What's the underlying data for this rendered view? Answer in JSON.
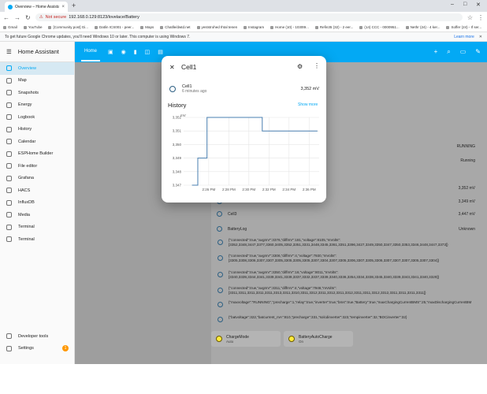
{
  "browser": {
    "tab_title": "Overview – Home Assistant",
    "not_secure": "Not secure",
    "url": "192.168.0.129:8123/lovelace/Battery",
    "bookmarks": [
      "Gmail",
      "YouTube",
      "[Community post] Gi...",
      "Datlin ICS001 - peer...",
      "Maps",
      "Chatlle/dwtd.net",
      "yeststrohed Ihtal tenen",
      "Instagram",
      "Home (10) - 1030t9...",
      "Refin35 (32) - 2 eer...",
      "(14) CCC - 0000951...",
      "Nethr (24) - 4 ker...",
      "Soffer (24) - If ser..."
    ],
    "info_text": "To get future Google Chrome updates, you'll need Windows 10 or later. This computer is using Windows 7.",
    "learn_more": "Learn more"
  },
  "sidebar": {
    "title": "Home Assistant",
    "items": [
      {
        "label": "Overview",
        "icon": "dashboard-icon",
        "active": true
      },
      {
        "label": "Map",
        "icon": "map-icon"
      },
      {
        "label": "Snapshots",
        "icon": "snapshot-icon"
      },
      {
        "label": "Energy",
        "icon": "lightning-icon"
      },
      {
        "label": "Logbook",
        "icon": "logbook-icon"
      },
      {
        "label": "History",
        "icon": "history-icon"
      },
      {
        "label": "Calendar",
        "icon": "calendar-icon"
      },
      {
        "label": "ESPHome Builder",
        "icon": "esphome-icon"
      },
      {
        "label": "File editor",
        "icon": "wrench-icon"
      },
      {
        "label": "Grafana",
        "icon": "grafana-icon"
      },
      {
        "label": "HACS",
        "icon": "hacs-icon"
      },
      {
        "label": "InfluxDB",
        "icon": "influxdb-icon"
      },
      {
        "label": "Media",
        "icon": "media-icon"
      },
      {
        "label": "Terminal",
        "icon": "terminal-icon"
      },
      {
        "label": "Terminal",
        "icon": "terminal-icon"
      }
    ],
    "developer_tools": "Developer tools",
    "settings": "Settings",
    "settings_badge": "1"
  },
  "topbar": {
    "home_tab": "Home"
  },
  "dialog": {
    "title": "Cell1",
    "entity_name": "Cell1",
    "last_changed": "6 minutes ago",
    "value": "3,352 mV",
    "history_title": "History",
    "show_more": "Show more"
  },
  "chart_data": {
    "type": "line",
    "unit": "mV",
    "x_ticks": [
      "2:26 PM",
      "2:28 PM",
      "2:30 PM",
      "2:32 PM",
      "2:34 PM",
      "2:36 PM"
    ],
    "y_ticks": [
      3347,
      3348,
      3349,
      3350,
      3351,
      3352
    ],
    "ylim": [
      3347,
      3352
    ],
    "series": [
      {
        "x": [
          "2:24:20",
          "2:24:55",
          "2:24:55",
          "2:25:50",
          "2:25:50",
          "2:31:20",
          "2:31:20",
          "2:36:50"
        ],
        "values": [
          3347,
          3347,
          3349,
          3349,
          3352,
          3352,
          3351,
          3351
        ]
      }
    ],
    "values": [
      3347,
      3349,
      3352,
      3351,
      3352
    ],
    "x_values_minutes": [
      24.3,
      24.9,
      25.8,
      31.3,
      36.8
    ]
  },
  "background_rows": [
    {
      "name": "",
      "value": "RUNNING",
      "icon": "eye-icon"
    },
    {
      "name": "",
      "value": "Running",
      "icon": "eye-icon"
    },
    {
      "name": "",
      "value": "3,352 mV",
      "icon": "eye-icon"
    },
    {
      "name": "Cell3",
      "value": "3,349 mV",
      "icon": "eye-icon"
    },
    {
      "name": "Cell3",
      "value": "3,447 mV",
      "icon": "eye-icon"
    },
    {
      "name": "BatteryLog",
      "value": "Unknown",
      "icon": "eye-icon"
    }
  ],
  "json_rows": [
    "{\"connected\":true,\"avgmV\":3376,\"diffmV\":181,\"voltage\":8105,\"mVolts\":\n[3352,3348,3447,3377,3360,3405,3352,3351,3331,3448,3345,3361,3351,3396,3427,3349,3350,3347,3350,3353,3346,3448,3447,3373]}",
    "{\"connected\":true,\"avgmV\":3306,\"diffmV\":4,\"voltage\":7930,\"mVolts\":\n[3305,3308,3306,3307,3307,3305,3305,3305,3305,3307,3304,3307,3305,3306,3307,3305,3306,3307,3307,3307,3305,3307,3304]}",
    "{\"connected\":true,\"avgmV\":3350,\"diffmV\":16,\"voltage\":8011,\"mVolts\":\n[3340,3339,3344,3341,3339,3341,3339,3337,3332,3337,3339,3340,3336,3354,3334,3338,3345,3340,3339,3343,3341,3340,3329]}",
    "{\"connected\":true,\"avgmV\":3311,\"diffmV\":4,\"voltage\":7946,\"mVolts\":\n[3311,3311,3311,3311,3311,3313,3311,3310,3311,3312,3311,3312,3311,3312,3311,3311,3312,3312,3311,3311,3311,3311]}",
    "{\"maxvoltage\":\"RUNNING\",\"precharge\":1,\"relay\":true,\"inverter\":true,\"bms\":true,\"Battery\":true,\"maxChargingCurrentBMS\":25,\"maxDischargingCurrentBM",
    "{\"batvoltage\":322,\"batcurrent_mA\":810,\"precharge\":331,\"solcdinverter\":323,\"tempinverter\":32,\"BOCinverter\":32}"
  ],
  "cards": [
    {
      "name": "ChargeMode",
      "state": "Auto",
      "icon": "battery-charge-icon"
    },
    {
      "name": "BatteryAutoCharge",
      "state": "On",
      "icon": "battery-charge-icon"
    }
  ]
}
